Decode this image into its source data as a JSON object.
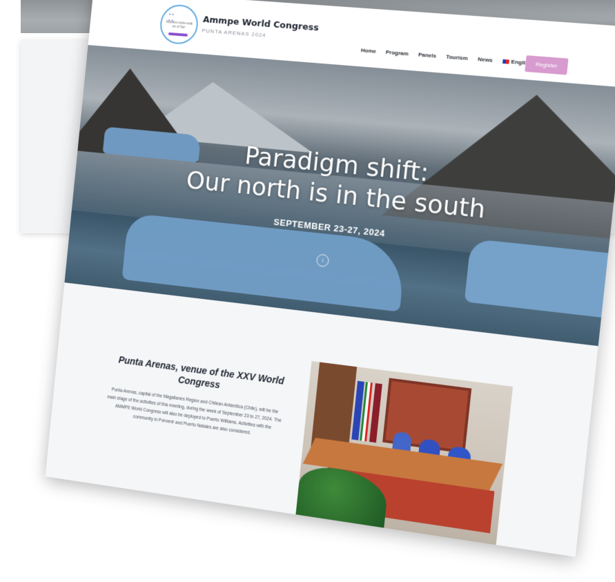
{
  "header": {
    "logo_text": "Nuestro norte está en el Sur",
    "brand_title": "Ammpe World Congress",
    "brand_subtitle": "PUNTA ARENAS 2024",
    "nav": [
      "Home",
      "Program",
      "Panels",
      "Tourism",
      "News"
    ],
    "language": "English",
    "register_label": "Register"
  },
  "hero": {
    "title_line1": "Paradigm shift:",
    "title_line2": "Our north is in the south",
    "date": "SEPTEMBER 23-27, 2024",
    "scroll_icon": "arrow-down-circle-icon"
  },
  "section": {
    "title": "Punta Arenas, venue of the XXV World Congress",
    "body": "Punta Arenas, capital of the Magallanes Region and Chilean Antarctica (Chile), will be the main stage of the activities of this meeting, during the week of September 23 to 27, 2024. The AMMPE World Congress will also be deployed to Puerto Williams. Activities with the community in Porvenir and Puerto Natales are also considered."
  },
  "colors": {
    "accent": "#d79bcf",
    "background": "#f4f6f8",
    "text": "#1f2430"
  }
}
